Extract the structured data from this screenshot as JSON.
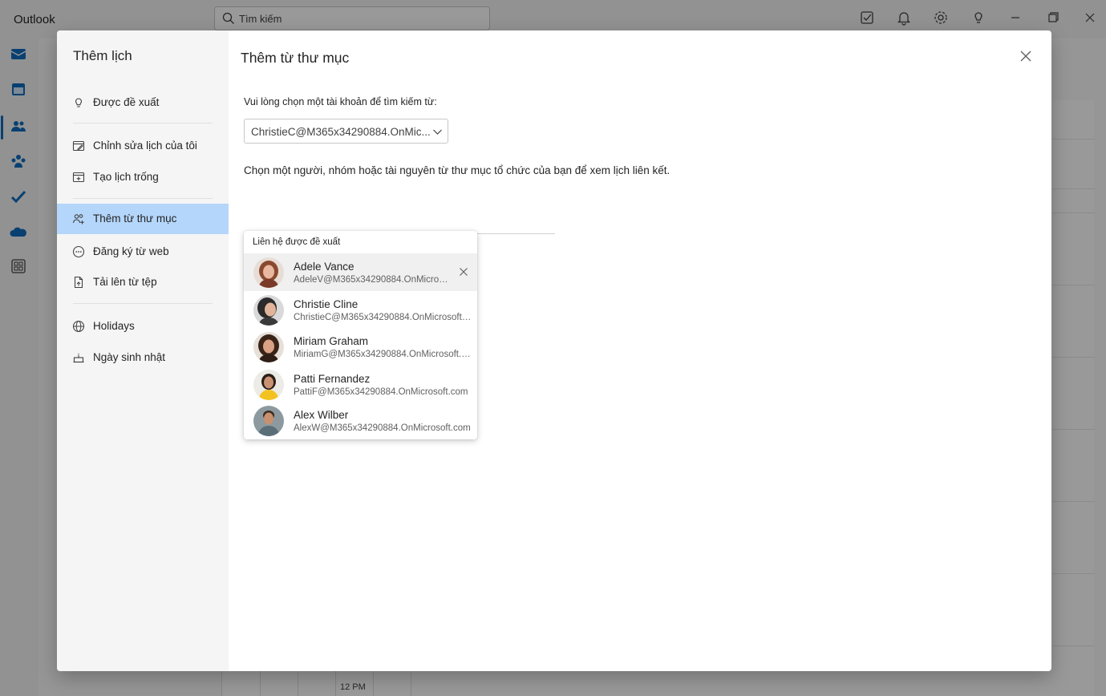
{
  "app": {
    "name": "Outlook"
  },
  "search": {
    "placeholder": "Tìm kiếm"
  },
  "background": {
    "time_label": "12 PM"
  },
  "dialog": {
    "nav_title": "Thêm lịch",
    "nav_items": [
      {
        "label": "Được đề xuất",
        "icon": "lightbulb-icon"
      },
      {
        "label": "Chỉnh sửa lịch của tôi",
        "icon": "edit-calendar-icon"
      },
      {
        "label": "Tạo lịch trống",
        "icon": "add-calendar-icon"
      },
      {
        "label": "Thêm từ thư mục",
        "icon": "people-add-icon",
        "selected": true
      },
      {
        "label": "Đăng ký từ web",
        "icon": "link-icon"
      },
      {
        "label": "Tải lên từ tệp",
        "icon": "upload-file-icon"
      },
      {
        "label": "Holidays",
        "icon": "globe-icon"
      },
      {
        "label": "Ngày sinh nhật",
        "icon": "birthday-cake-icon"
      }
    ],
    "content_title": "Thêm từ thư mục",
    "account_prompt": "Vui lòng chọn một tài khoản để tìm kiếm từ:",
    "account_selected": "ChristieC@M365x34290884.OnMic...",
    "description": "Chọn một người, nhóm hoặc tài nguyên từ thư mục tổ chức của bạn để xem lịch liên kết.",
    "suggestions_header": "Liên hệ được đề xuất",
    "contacts": [
      {
        "name": "Adele Vance",
        "email": "AdeleV@M365x34290884.OnMicrosoft.com"
      },
      {
        "name": "Christie Cline",
        "email": "ChristieC@M365x34290884.OnMicrosoft.com"
      },
      {
        "name": "Miriam Graham",
        "email": "MiriamG@M365x34290884.OnMicrosoft.com"
      },
      {
        "name": "Patti Fernandez",
        "email": "PattiF@M365x34290884.OnMicrosoft.com"
      },
      {
        "name": "Alex Wilber",
        "email": "AlexW@M365x34290884.OnMicrosoft.com"
      }
    ]
  },
  "colors": {
    "accent": "#0f6cbd",
    "selected_nav": "#b4d6fa",
    "overlay": "#666666"
  }
}
